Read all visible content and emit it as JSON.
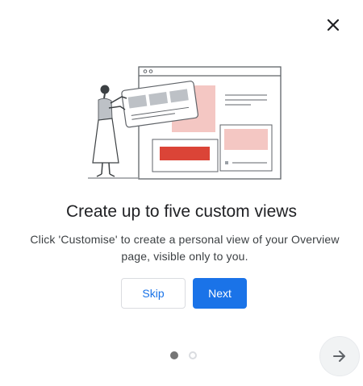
{
  "dialog": {
    "title": "Create up to five custom views",
    "description": "Click 'Customise' to create a personal view of your Overview page, visible only to you.",
    "skip_label": "Skip",
    "next_label": "Next",
    "close_icon": "close-icon",
    "arrow_icon": "arrow-right-icon"
  },
  "pagination": {
    "current": 1,
    "total": 2
  },
  "colors": {
    "primary": "#1a73e8",
    "accent_red": "#db4437",
    "pink": "#f4c7c3"
  }
}
